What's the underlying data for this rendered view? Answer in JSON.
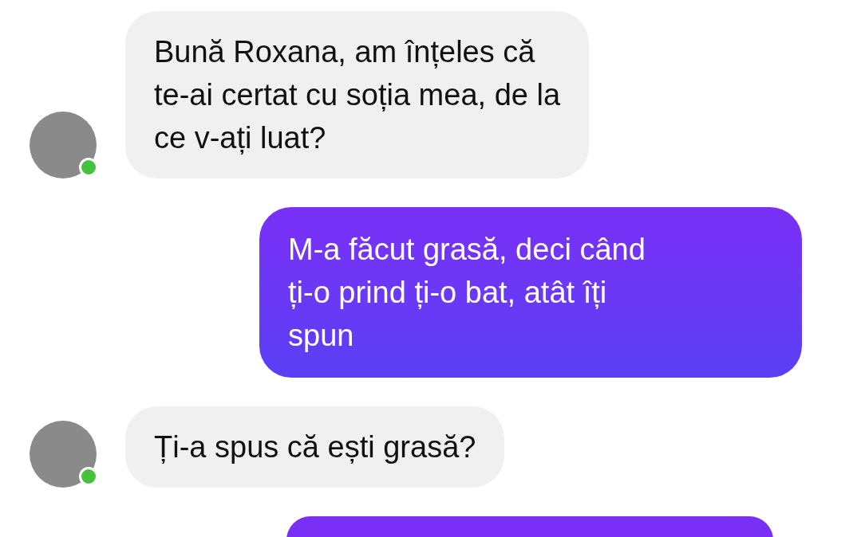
{
  "messages": [
    {
      "kind": "received",
      "text": "Bună Roxana, am înțeles că\nte-ai certat cu soția mea, de la\nce v-ați luat?",
      "online": true
    },
    {
      "kind": "sent",
      "text": "M-a făcut grasă, deci când\nți-o prind ți-o bat, atât îți\nspun"
    },
    {
      "kind": "received",
      "text": "Ți-a spus că ești grasă?",
      "online": true
    },
    {
      "kind": "sent"
    }
  ]
}
